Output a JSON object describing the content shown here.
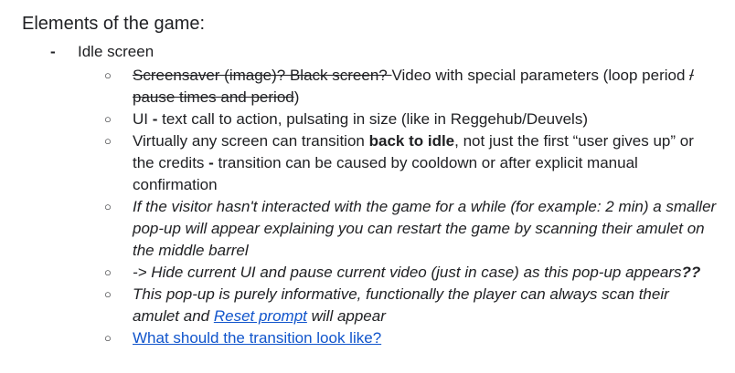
{
  "heading": "Elements of the game:",
  "section": {
    "marker": "-",
    "title": "Idle screen"
  },
  "bullet_glyph": "○",
  "items": [
    {
      "strike1": "Screensaver (image)? Black screen? ",
      "text1": "Video with special parameters (loop period ",
      "strike2": "/ pause times and period",
      "text2": ")"
    },
    {
      "pre": "UI ",
      "bold": "-",
      "post": " text call to action, pulsating in size (like in Reggehub/Deuvels)"
    },
    {
      "pre": "Virtually any screen can transition ",
      "bold1": "back to idle",
      "mid": ", not just the first “user gives up” or the credits ",
      "bold2": "-",
      "post": " transition can be caused by cooldown or after explicit manual confirmation"
    },
    {
      "text": "If the visitor hasn't interacted with the game for a while (for example: 2 min) a smaller pop-up will appear explaining you can restart the game by scanning their amulet on the middle barrel"
    },
    {
      "text": "-> Hide current UI and pause current video (just in case) as this pop-up appears",
      "bold": "??"
    },
    {
      "pre": "This pop-up is purely informative, functionally the player can always scan their amulet and ",
      "link": "Reset prompt",
      "post": " will appear"
    },
    {
      "link": "What should the transition look like?"
    }
  ]
}
